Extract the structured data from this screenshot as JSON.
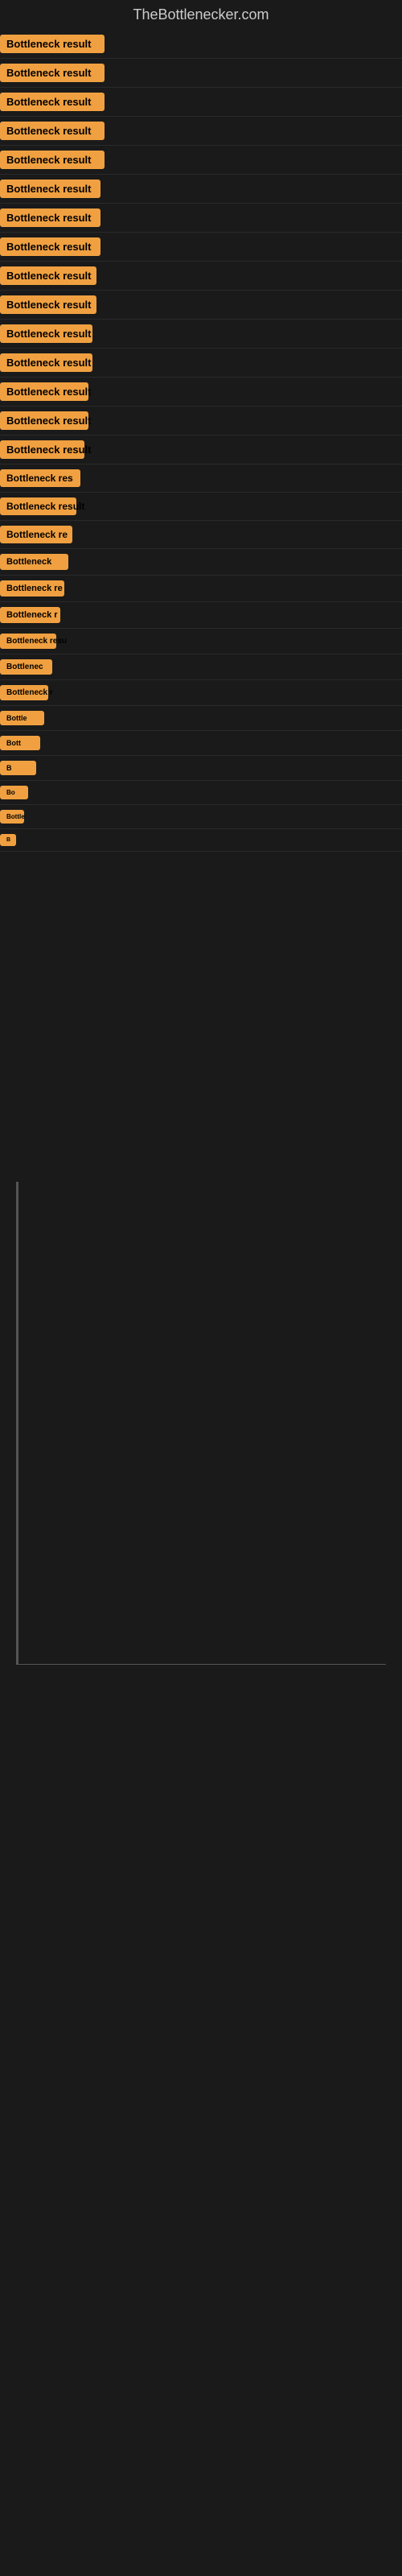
{
  "site": {
    "title": "TheBottlenecker.com"
  },
  "rows": [
    {
      "id": 1,
      "label": "Bottleneck result",
      "width": 130
    },
    {
      "id": 2,
      "label": "Bottleneck result",
      "width": 130
    },
    {
      "id": 3,
      "label": "Bottleneck result",
      "width": 130
    },
    {
      "id": 4,
      "label": "Bottleneck result",
      "width": 130
    },
    {
      "id": 5,
      "label": "Bottleneck result",
      "width": 130
    },
    {
      "id": 6,
      "label": "Bottleneck result",
      "width": 125
    },
    {
      "id": 7,
      "label": "Bottleneck result",
      "width": 125
    },
    {
      "id": 8,
      "label": "Bottleneck result",
      "width": 125
    },
    {
      "id": 9,
      "label": "Bottleneck result",
      "width": 120
    },
    {
      "id": 10,
      "label": "Bottleneck result",
      "width": 120
    },
    {
      "id": 11,
      "label": "Bottleneck result",
      "width": 115
    },
    {
      "id": 12,
      "label": "Bottleneck result",
      "width": 115
    },
    {
      "id": 13,
      "label": "Bottleneck result",
      "width": 110
    },
    {
      "id": 14,
      "label": "Bottleneck result",
      "width": 110
    },
    {
      "id": 15,
      "label": "Bottleneck result",
      "width": 105
    },
    {
      "id": 16,
      "label": "Bottleneck res",
      "width": 100
    },
    {
      "id": 17,
      "label": "Bottleneck result",
      "width": 95
    },
    {
      "id": 18,
      "label": "Bottleneck re",
      "width": 90
    },
    {
      "id": 19,
      "label": "Bottleneck",
      "width": 85
    },
    {
      "id": 20,
      "label": "Bottleneck re",
      "width": 80
    },
    {
      "id": 21,
      "label": "Bottleneck r",
      "width": 75
    },
    {
      "id": 22,
      "label": "Bottleneck resu",
      "width": 70
    },
    {
      "id": 23,
      "label": "Bottlenec",
      "width": 65
    },
    {
      "id": 24,
      "label": "Bottleneck r",
      "width": 60
    },
    {
      "id": 25,
      "label": "Bottle",
      "width": 55
    },
    {
      "id": 26,
      "label": "Bott",
      "width": 50
    },
    {
      "id": 27,
      "label": "B",
      "width": 45
    },
    {
      "id": 28,
      "label": "Bo",
      "width": 35
    },
    {
      "id": 29,
      "label": "Bottle",
      "width": 30
    },
    {
      "id": 30,
      "label": "B",
      "width": 20
    }
  ]
}
